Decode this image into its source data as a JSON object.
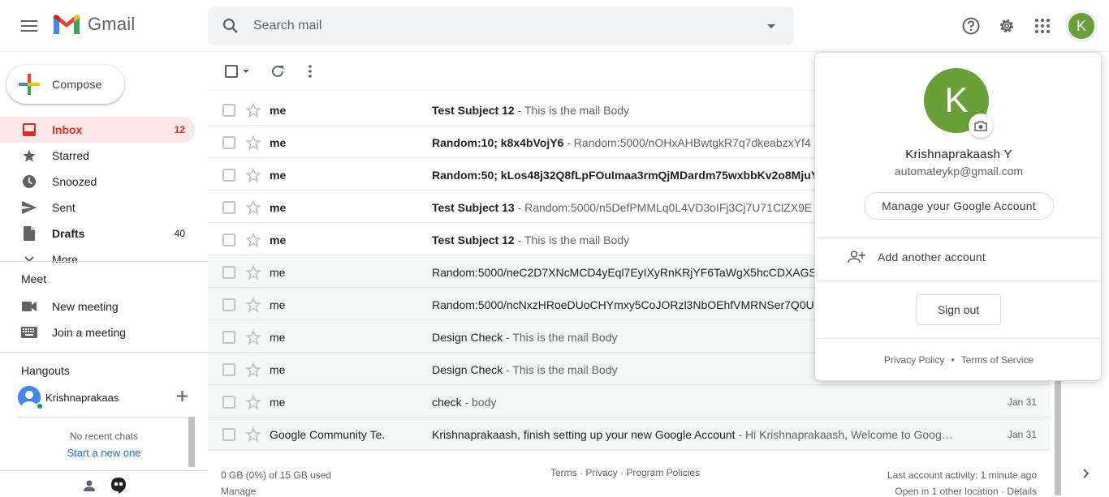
{
  "header": {
    "app_name": "Gmail",
    "search_placeholder": "Search mail",
    "avatar_letter": "K"
  },
  "icons": [
    "menu-icon",
    "gmail-logo",
    "search-icon",
    "dropdown-icon",
    "help-icon",
    "gear-icon",
    "apps-icon",
    "avatar",
    "checkbox",
    "refresh-icon",
    "more-icon",
    "star-icon",
    "camera-icon",
    "add-person-icon",
    "inbox-icon",
    "star-icon",
    "clock-icon",
    "send-icon",
    "file-icon",
    "video-icon",
    "keyboard-icon",
    "person-icon",
    "hangouts-icon",
    "chevron-right-icon"
  ],
  "colors": {
    "accent_red": "#d93025",
    "avatar_green": "#689f38",
    "link_blue": "#1a73e8"
  },
  "sidebar": {
    "compose": "Compose",
    "items": [
      {
        "label": "Inbox",
        "count": "12"
      },
      {
        "label": "Starred",
        "count": ""
      },
      {
        "label": "Snoozed",
        "count": ""
      },
      {
        "label": "Sent",
        "count": ""
      },
      {
        "label": "Drafts",
        "count": "40"
      },
      {
        "label": "More",
        "count": ""
      }
    ],
    "meet": {
      "title": "Meet",
      "new_meeting": "New meeting",
      "join_meeting": "Join a meeting"
    },
    "hangouts": {
      "title": "Hangouts",
      "user": "Krishnaprakaas",
      "no_chats": "No recent chats",
      "start_new": "Start a new one"
    }
  },
  "mails": [
    {
      "sender": "me",
      "subject": "Test Subject 12",
      "snippet": " - This is the mail Body",
      "date": "",
      "unread": true
    },
    {
      "sender": "me",
      "subject": "Random:10; k8x4bVojY6",
      "snippet": " - Random:5000/nOHxAHBwtgkR7q7dkeabzxYf4",
      "date": "",
      "unread": true
    },
    {
      "sender": "me",
      "subject": "Random:50; kLos48j32Q8fLpFOuImaa3rmQjMDardm75wxbbKv2o8MjuYr",
      "snippet": "",
      "date": "",
      "unread": true
    },
    {
      "sender": "me",
      "subject": "Test Subject 13",
      "snippet": " - Random:5000/n5DefPMMLq0L4VD3oIFj3Cj7U71ClZX9E",
      "date": "",
      "unread": true
    },
    {
      "sender": "me",
      "subject": "Test Subject 12",
      "snippet": " - This is the mail Body",
      "date": "",
      "unread": true
    },
    {
      "sender": "me",
      "subject": "Random:5000/neC2D7XNcMCD4yEql7EyIXyRnKRjYF6TaWgX5hcCDXAGSL",
      "snippet": "",
      "date": "",
      "unread": false
    },
    {
      "sender": "me",
      "subject": "Random:5000/ncNxzHRoeDUoCHYmxy5CoJORzl3NbOEhfVMRNSer7Q0U",
      "snippet": "",
      "date": "",
      "unread": false
    },
    {
      "sender": "me",
      "subject": "Design Check",
      "snippet": " - This is the mail Body",
      "date": "",
      "unread": false
    },
    {
      "sender": "me",
      "subject": "Design Check",
      "snippet": " - This is the mail Body",
      "date": "",
      "unread": false
    },
    {
      "sender": "me",
      "subject": "check",
      "snippet": " - body",
      "date": "Jan 31",
      "unread": false
    },
    {
      "sender": "Google Community Te.",
      "subject": "Krishnaprakaash, finish setting up your new Google Account",
      "snippet": " - Hi Krishnaprakaash, Welcome to Goog…",
      "date": "Jan 31",
      "unread": false
    }
  ],
  "footer": {
    "storage": "0 GB (0%) of 15 GB used",
    "manage": "Manage",
    "links": "Terms · Privacy · Program Policies",
    "activity": "Last account activity: 1 minute ago",
    "location": "Open in 1 other location · Details"
  },
  "account_popup": {
    "letter": "K",
    "name": "Krishnaprakaash Y",
    "email": "automateykp@gmail.com",
    "manage": "Manage your Google Account",
    "add_account": "Add another account",
    "sign_out": "Sign out",
    "privacy": "Privacy Policy",
    "dot": "•",
    "terms": "Terms of Service"
  }
}
